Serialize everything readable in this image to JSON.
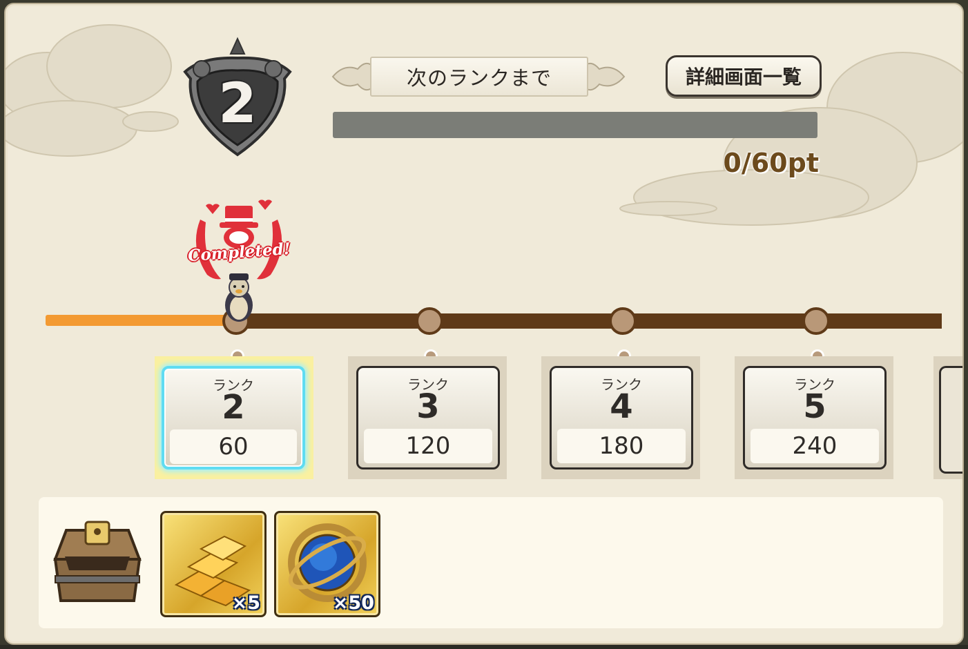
{
  "rank": {
    "current": "2"
  },
  "next_rank": {
    "label": "次のランクまで",
    "points_text": "0/60pt",
    "progress_fraction": 0.0
  },
  "detail_button": {
    "label": "詳細画面一覧"
  },
  "completed_stamp": {
    "text": "Completed!"
  },
  "rank_cards": [
    {
      "label": "ランク",
      "rank": "2",
      "points": "60",
      "active": true
    },
    {
      "label": "ランク",
      "rank": "3",
      "points": "120",
      "active": false
    },
    {
      "label": "ランク",
      "rank": "4",
      "points": "180",
      "active": false
    },
    {
      "label": "ランク",
      "rank": "5",
      "points": "240",
      "active": false
    }
  ],
  "rewards": [
    {
      "icon": "gold-bars-icon",
      "quantity": "×5"
    },
    {
      "icon": "astrolabe-orb-icon",
      "quantity": "×50"
    }
  ],
  "colors": {
    "progress_orange": "#f39a32",
    "track_brown": "#5f3a18",
    "active_glow": "#5fdcf2"
  }
}
